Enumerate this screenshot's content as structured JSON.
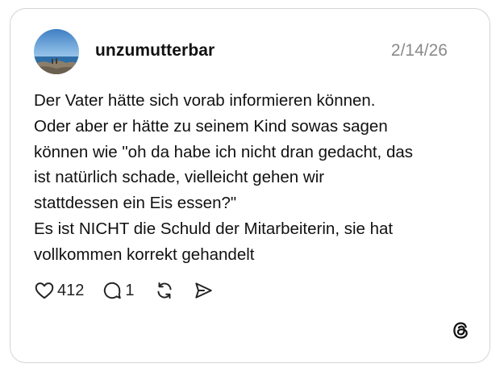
{
  "post": {
    "username": "unzumutterbar",
    "date": "2/14/26",
    "body_lines": [
      "Der Vater hätte sich vorab informieren können.",
      "Oder aber er hätte zu seinem Kind sowas sagen",
      "können wie \"oh da habe ich nicht dran gedacht, das",
      "ist natürlich schade, vielleicht gehen wir",
      "stattdessen ein Eis essen?\"",
      "Es ist NICHT die Schuld der Mitarbeiterin, sie hat",
      "vollkommen korrekt gehandelt"
    ]
  },
  "actions": {
    "like_count": "412",
    "reply_count": "1"
  },
  "icons": {
    "like": "heart-icon",
    "reply": "speech-bubble-icon",
    "repost": "repost-icon",
    "share": "send-icon",
    "brand": "threads-logo-icon"
  },
  "colors": {
    "text": "#111111",
    "muted": "#8a8a8a",
    "border": "#d4d4d4",
    "background": "#ffffff"
  }
}
